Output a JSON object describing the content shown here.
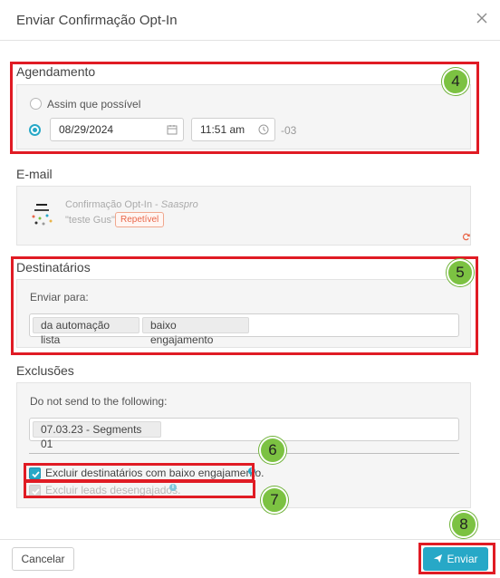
{
  "dialog": {
    "title": "Enviar Confirmação Opt-In",
    "close_icon": "close-icon"
  },
  "agendamento": {
    "label": "Agendamento",
    "option_asap": "Assim que possível",
    "selected": "scheduled",
    "date_value": "08/29/2024",
    "time_value": "11:51 am",
    "timezone": "-03"
  },
  "email": {
    "label": "E-mail",
    "name": "Confirmação Opt-In - ",
    "brand": "Saaspro",
    "subject": "\"teste Gus\"",
    "badge": "Repetível",
    "refresh_icon": "refresh-icon"
  },
  "destinatarios": {
    "label": "Destinatários",
    "send_to_label": "Enviar para:",
    "tags": [
      "da automação lista",
      "baixo engajamento"
    ]
  },
  "exclusoes": {
    "label": "Exclusões",
    "do_not_send_label": "Do not send to the following:",
    "tags": [
      "07.03.23 - Segments 01"
    ],
    "exclude_low_engagement": "Excluir destinatários com baixo engajamento.",
    "exclude_low_engagement_checked": true,
    "exclude_disengaged": "Excluir leads desengajados.",
    "exclude_disengaged_checked": true,
    "exclude_disengaged_disabled": true
  },
  "annotations": {
    "markers": [
      "4",
      "5",
      "6",
      "7",
      "8"
    ],
    "highlight_color": "#e01b24",
    "marker_color": "#7cc242"
  },
  "footer": {
    "cancel_label": "Cancelar",
    "send_label": "Enviar",
    "send_icon": "paper-plane-icon"
  },
  "colors": {
    "accent": "#27a8c7",
    "badge": "#e9674a"
  }
}
